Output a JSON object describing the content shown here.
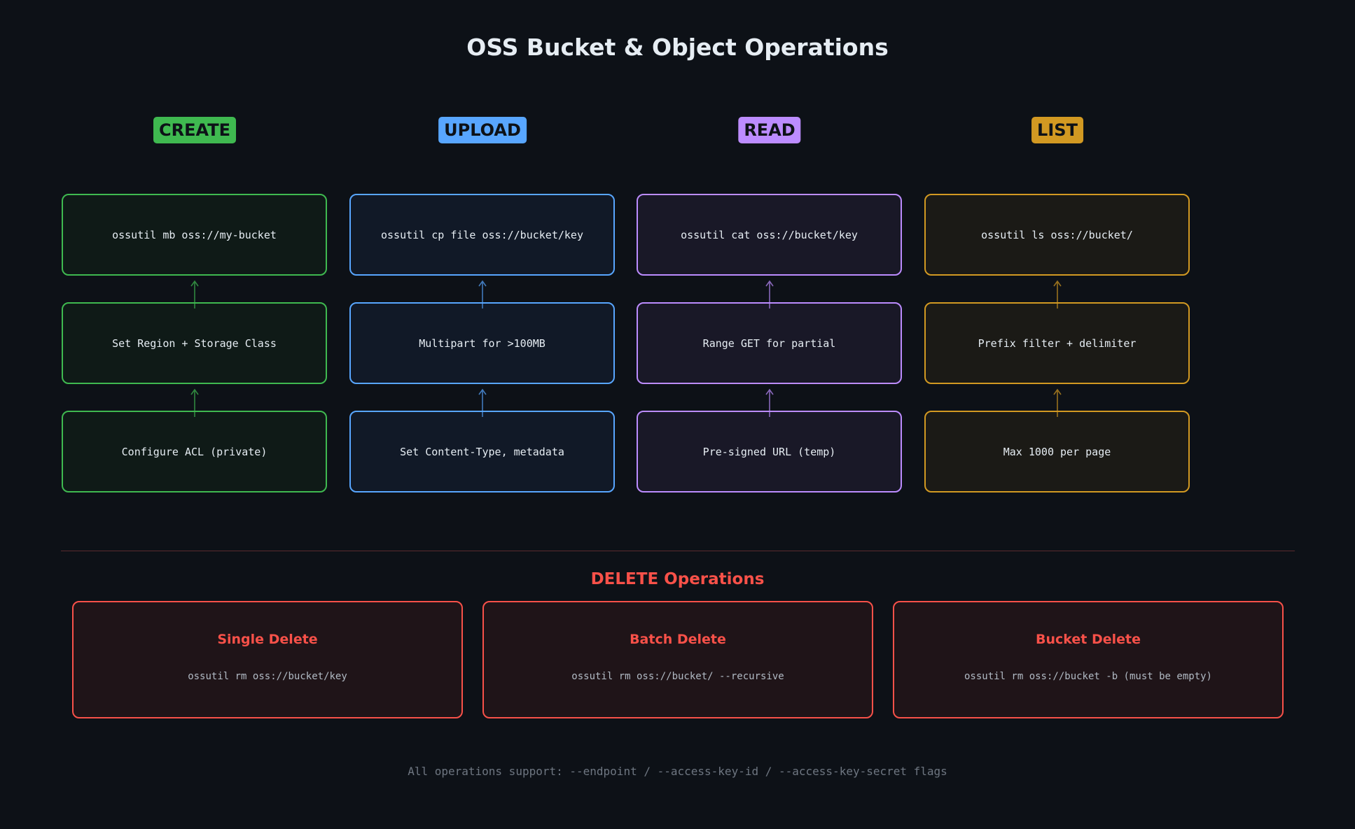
{
  "title": "OSS Bucket & Object Operations",
  "columns": [
    {
      "label": "CREATE",
      "accent": "#3fb950",
      "box_fill": "#0f1a17",
      "steps": [
        "ossutil mb oss://my-bucket",
        "Set Region + Storage Class",
        "Configure ACL (private)"
      ]
    },
    {
      "label": "UPLOAD",
      "accent": "#58a6ff",
      "box_fill": "#111927",
      "steps": [
        "ossutil cp file oss://bucket/key",
        "Multipart for >100MB",
        "Set Content-Type, metadata"
      ]
    },
    {
      "label": "READ",
      "accent": "#bc8cff",
      "box_fill": "#191827",
      "steps": [
        "ossutil cat oss://bucket/key",
        "Range GET for partial",
        "Pre-signed URL (temp)"
      ]
    },
    {
      "label": "LIST",
      "accent": "#d29922",
      "box_fill": "#1b1a16",
      "steps": [
        "ossutil ls oss://bucket/",
        "Prefix filter + delimiter",
        "Max 1000 per page"
      ]
    }
  ],
  "delete": {
    "heading": "DELETE Operations",
    "accent": "#f85149",
    "items": [
      {
        "name": "Single Delete",
        "command": "ossutil rm oss://bucket/key"
      },
      {
        "name": "Batch Delete",
        "command": "ossutil rm oss://bucket/ --recursive"
      },
      {
        "name": "Bucket Delete",
        "command": "ossutil rm oss://bucket -b (must be empty)"
      }
    ]
  },
  "footer": "All operations support: --endpoint / --access-key-id / --access-key-secret flags"
}
